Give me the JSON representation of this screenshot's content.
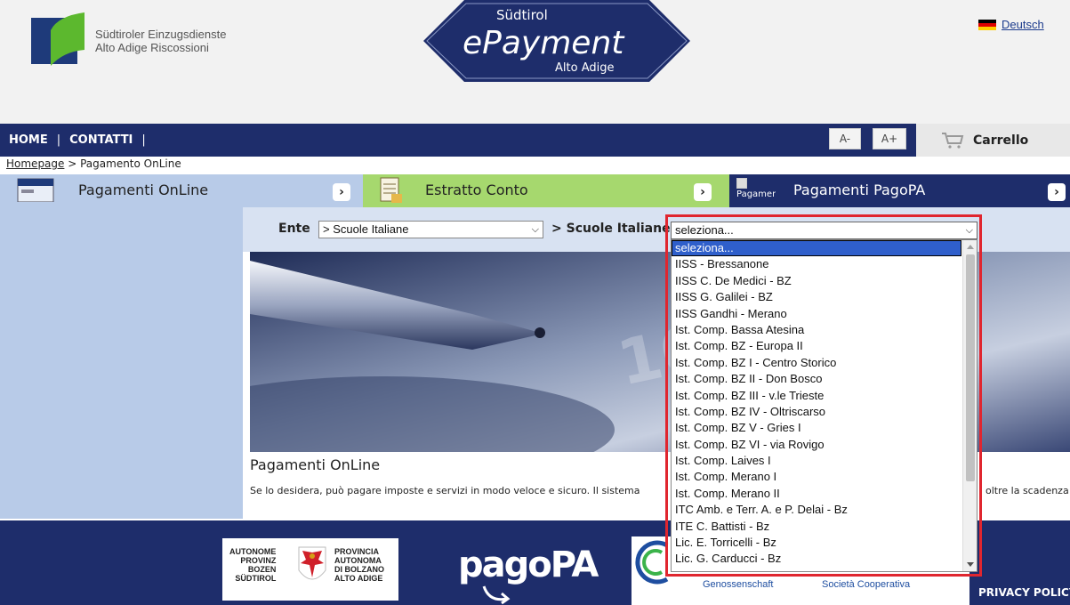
{
  "header": {
    "org_line1": "Südtiroler Einzugsdienste",
    "org_line2": "Alto Adige Riscossioni",
    "epay_top": "Südtirol",
    "epay_main": "ePayment",
    "epay_bottom": "Alto Adige",
    "language_link": "Deutsch"
  },
  "nav": {
    "home": "HOME",
    "sep1": "|",
    "contatti": "CONTATTI",
    "sep2": "|",
    "font_decrease": "A-",
    "font_increase": "A+",
    "cart": "Carrello"
  },
  "breadcrumb": {
    "home": "Homepage",
    "current": " > Pagamento OnLine"
  },
  "tabs": [
    {
      "label": "Pagamenti OnLine",
      "color": "#b8cbe8"
    },
    {
      "label": "Estratto Conto",
      "color": "#a6d86e"
    },
    {
      "label": "Pagamenti PagoPA",
      "color": "#1e2d6b",
      "img_alt": "Pagamento"
    }
  ],
  "filter": {
    "ente_label": "Ente",
    "ente_value": "> Scuole Italiane",
    "scuole_label": "> Scuole Italiane",
    "scuola_value": "seleziona..."
  },
  "dropdown_options": [
    "seleziona...",
    "IISS - Bressanone",
    "IISS C. De Medici - BZ",
    "IISS G. Galilei - BZ",
    "IISS Gandhi - Merano",
    "Ist. Comp. Bassa Atesina",
    "Ist. Comp. BZ - Europa II",
    "Ist. Comp. BZ I - Centro Storico",
    "Ist. Comp. BZ II - Don Bosco",
    "Ist. Comp. BZ III - v.le Trieste",
    "Ist. Comp. BZ IV - Oltriscarso",
    "Ist. Comp. BZ V - Gries I",
    "Ist. Comp. BZ VI - via Rovigo",
    "Ist. Comp. Laives I",
    "Ist. Comp. Merano I",
    "Ist. Comp. Merano II",
    "ITC Amb. e Terr. A. e P. Delai - Bz",
    "ITE C. Battisti - Bz",
    "Lic. E. Torricelli - Bz",
    "Lic. G. Carducci - Bz"
  ],
  "content": {
    "title": "Pagamenti OnLine",
    "text": "Se lo desidera, può pagare imposte e servizi in modo veloce e sicuro. Il sistema",
    "text_tail": "oltre la scadenza"
  },
  "footer": {
    "left_lines": [
      "AUTONOME",
      "PROVINZ",
      "BOZEN",
      "SÜDTIROL"
    ],
    "right_lines": [
      "PROVINCIA",
      "AUTONOMA",
      "DI BOLZANO",
      "ALTO ADIGE"
    ],
    "pagopa": "pagoPA",
    "genossenschaft": "Genossenschaft",
    "cooperativa": "Società Cooperativa",
    "privacy": "PRIVACY POLICY"
  }
}
